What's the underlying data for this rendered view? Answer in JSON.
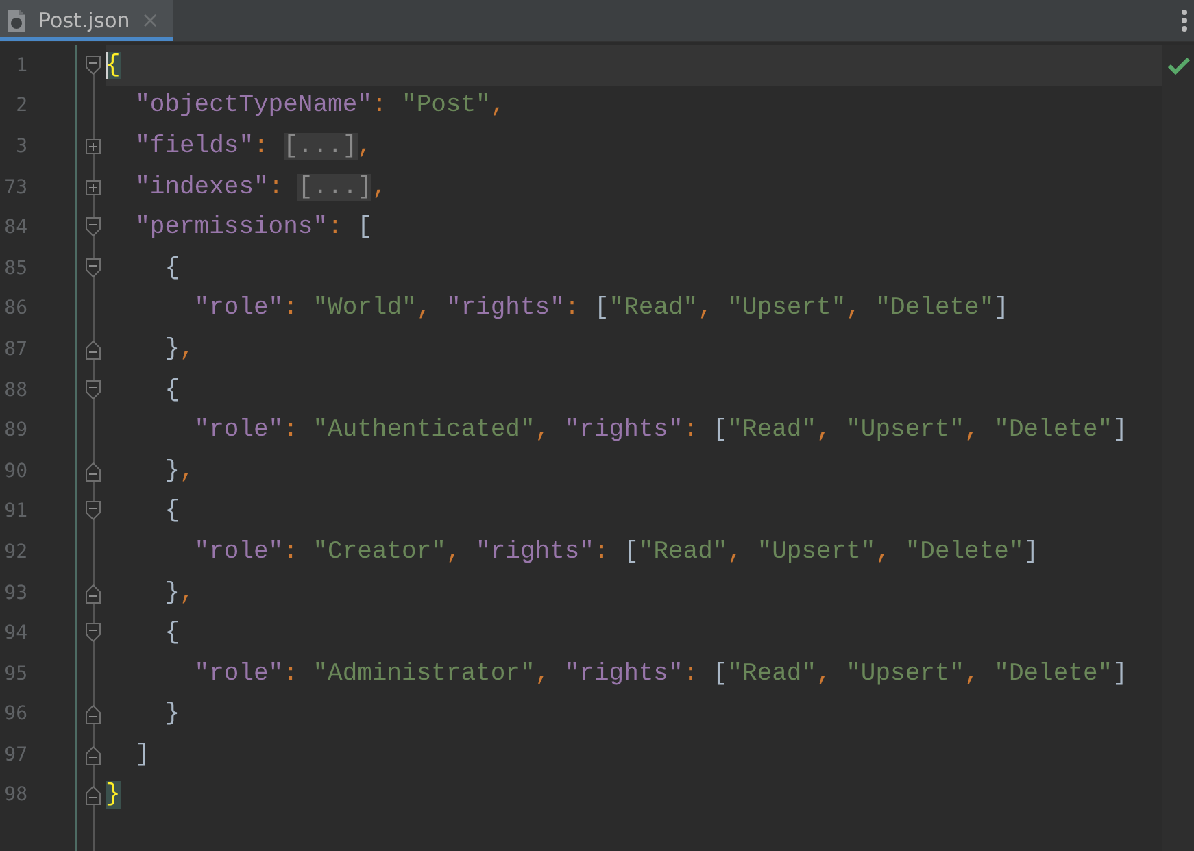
{
  "tab": {
    "title": "Post.json",
    "selected": true,
    "close": "×"
  },
  "inspection": {
    "ok": true
  },
  "lines": [
    {
      "number": "1",
      "kind": "open",
      "current": true,
      "tokens": [
        {
          "kind": "match",
          "t": "{"
        }
      ],
      "children": [
        {
          "number": "2",
          "current": false,
          "tokens": [
            {
              "kind": "key",
              "t": "\"objectTypeName\""
            },
            {
              "kind": "punct",
              "t": ": "
            },
            {
              "kind": "string",
              "t": "\"Post\""
            },
            {
              "kind": "punct",
              "t": ","
            }
          ]
        },
        {
          "number": "3",
          "kind": "collapsed",
          "current": false,
          "tokens": [
            {
              "kind": "key",
              "t": "\"fields\""
            },
            {
              "kind": "punct",
              "t": ": "
            },
            {
              "kind": "folded",
              "t": "[...]"
            },
            {
              "kind": "punct",
              "t": ","
            }
          ]
        },
        {
          "number": "73",
          "kind": "collapsed",
          "current": false,
          "tokens": [
            {
              "kind": "key",
              "t": "\"indexes\""
            },
            {
              "kind": "punct",
              "t": ": "
            },
            {
              "kind": "folded",
              "t": "[...]"
            },
            {
              "kind": "punct",
              "t": ","
            }
          ]
        },
        {
          "number": "84",
          "kind": "open",
          "current": false,
          "tokens": [
            {
              "kind": "key",
              "t": "\"permissions\""
            },
            {
              "kind": "punct",
              "t": ": "
            },
            {
              "kind": "bracket",
              "t": "["
            }
          ],
          "children": [
            {
              "number": "85",
              "kind": "open",
              "current": false,
              "tokens": [
                {
                  "kind": "bracket",
                  "t": "{"
                }
              ],
              "children": [
                {
                  "number": "86",
                  "current": false,
                  "tokens": [
                    {
                      "kind": "key",
                      "t": "\"role\""
                    },
                    {
                      "kind": "punct",
                      "t": ": "
                    },
                    {
                      "kind": "string",
                      "t": "\"World\""
                    },
                    {
                      "kind": "punct",
                      "t": ", "
                    },
                    {
                      "kind": "key",
                      "t": "\"rights\""
                    },
                    {
                      "kind": "punct",
                      "t": ": "
                    },
                    {
                      "kind": "bracket",
                      "t": "["
                    },
                    {
                      "kind": "string",
                      "t": "\"Read\""
                    },
                    {
                      "kind": "punct",
                      "t": ", "
                    },
                    {
                      "kind": "string",
                      "t": "\"Upsert\""
                    },
                    {
                      "kind": "punct",
                      "t": ", "
                    },
                    {
                      "kind": "string",
                      "t": "\"Delete\""
                    },
                    {
                      "kind": "bracket",
                      "t": "]"
                    }
                  ]
                }
              ]
            },
            {
              "number": "87",
              "kind": "close",
              "current": false,
              "tokens": [
                {
                  "kind": "bracket",
                  "t": "}"
                },
                {
                  "kind": "punct",
                  "t": ","
                }
              ]
            },
            {
              "number": "88",
              "kind": "open",
              "current": false,
              "tokens": [
                {
                  "kind": "bracket",
                  "t": "{"
                }
              ],
              "children": [
                {
                  "number": "89",
                  "current": false,
                  "tokens": [
                    {
                      "kind": "key",
                      "t": "\"role\""
                    },
                    {
                      "kind": "punct",
                      "t": ": "
                    },
                    {
                      "kind": "string",
                      "t": "\"Authenticated\""
                    },
                    {
                      "kind": "punct",
                      "t": ", "
                    },
                    {
                      "kind": "key",
                      "t": "\"rights\""
                    },
                    {
                      "kind": "punct",
                      "t": ": "
                    },
                    {
                      "kind": "bracket",
                      "t": "["
                    },
                    {
                      "kind": "string",
                      "t": "\"Read\""
                    },
                    {
                      "kind": "punct",
                      "t": ", "
                    },
                    {
                      "kind": "string",
                      "t": "\"Upsert\""
                    },
                    {
                      "kind": "punct",
                      "t": ", "
                    },
                    {
                      "kind": "string",
                      "t": "\"Delete\""
                    },
                    {
                      "kind": "bracket",
                      "t": "]"
                    }
                  ]
                }
              ]
            },
            {
              "number": "90",
              "kind": "close",
              "current": false,
              "tokens": [
                {
                  "kind": "bracket",
                  "t": "}"
                },
                {
                  "kind": "punct",
                  "t": ","
                }
              ]
            },
            {
              "number": "91",
              "kind": "open",
              "current": false,
              "tokens": [
                {
                  "kind": "bracket",
                  "t": "{"
                }
              ],
              "children": [
                {
                  "number": "92",
                  "current": false,
                  "tokens": [
                    {
                      "kind": "key",
                      "t": "\"role\""
                    },
                    {
                      "kind": "punct",
                      "t": ": "
                    },
                    {
                      "kind": "string",
                      "t": "\"Creator\""
                    },
                    {
                      "kind": "punct",
                      "t": ", "
                    },
                    {
                      "kind": "key",
                      "t": "\"rights\""
                    },
                    {
                      "kind": "punct",
                      "t": ": "
                    },
                    {
                      "kind": "bracket",
                      "t": "["
                    },
                    {
                      "kind": "string",
                      "t": "\"Read\""
                    },
                    {
                      "kind": "punct",
                      "t": ", "
                    },
                    {
                      "kind": "string",
                      "t": "\"Upsert\""
                    },
                    {
                      "kind": "punct",
                      "t": ", "
                    },
                    {
                      "kind": "string",
                      "t": "\"Delete\""
                    },
                    {
                      "kind": "bracket",
                      "t": "]"
                    }
                  ]
                }
              ]
            },
            {
              "number": "93",
              "kind": "close",
              "current": false,
              "tokens": [
                {
                  "kind": "bracket",
                  "t": "}"
                },
                {
                  "kind": "punct",
                  "t": ","
                }
              ]
            },
            {
              "number": "94",
              "kind": "open",
              "current": false,
              "tokens": [
                {
                  "kind": "bracket",
                  "t": "{"
                }
              ],
              "children": [
                {
                  "number": "95",
                  "current": false,
                  "tokens": [
                    {
                      "kind": "key",
                      "t": "\"role\""
                    },
                    {
                      "kind": "punct",
                      "t": ": "
                    },
                    {
                      "kind": "string",
                      "t": "\"Administrator\""
                    },
                    {
                      "kind": "punct",
                      "t": ", "
                    },
                    {
                      "kind": "key",
                      "t": "\"rights\""
                    },
                    {
                      "kind": "punct",
                      "t": ": "
                    },
                    {
                      "kind": "bracket",
                      "t": "["
                    },
                    {
                      "kind": "string",
                      "t": "\"Read\""
                    },
                    {
                      "kind": "punct",
                      "t": ", "
                    },
                    {
                      "kind": "string",
                      "t": "\"Upsert\""
                    },
                    {
                      "kind": "punct",
                      "t": ", "
                    },
                    {
                      "kind": "string",
                      "t": "\"Delete\""
                    },
                    {
                      "kind": "bracket",
                      "t": "]"
                    }
                  ]
                }
              ]
            },
            {
              "number": "96",
              "kind": "close",
              "current": false,
              "tokens": [
                {
                  "kind": "bracket",
                  "t": "}"
                }
              ]
            }
          ]
        },
        {
          "number": "97",
          "kind": "close",
          "current": false,
          "tokens": [
            {
              "kind": "bracket",
              "t": "]"
            }
          ]
        }
      ]
    },
    {
      "number": "98",
      "kind": "close",
      "current": false,
      "tokens": [
        {
          "kind": "match",
          "t": "}"
        }
      ]
    }
  ]
}
